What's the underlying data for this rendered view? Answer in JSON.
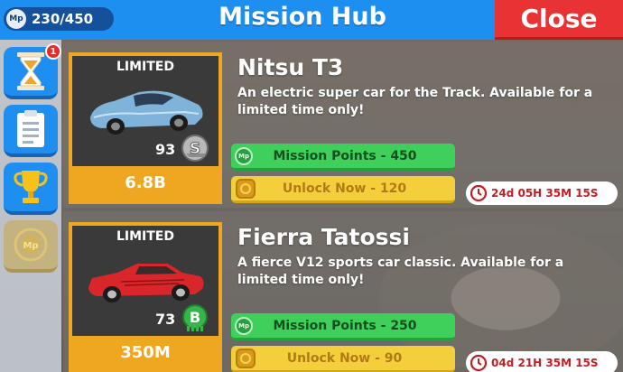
{
  "header": {
    "mission_points": "230/450",
    "mp_badge": "Mp",
    "title": "Mission Hub",
    "close_label": "Close"
  },
  "sidebar": {
    "notification_count": "1",
    "items": [
      {
        "name": "hourglass",
        "icon": "hourglass-icon"
      },
      {
        "name": "clipboard",
        "icon": "clipboard-icon"
      },
      {
        "name": "trophy",
        "icon": "trophy-icon"
      },
      {
        "name": "mission-points",
        "icon": "mp-icon",
        "label": "Mp",
        "disabled": true
      }
    ]
  },
  "colors": {
    "header_blue": "#1c8ff0",
    "close_red": "#e83234",
    "mission_green": "#3fd05c",
    "unlock_yellow": "#f4cf3c",
    "card_frame_gold": "#efa621",
    "timer_red": "#c51d23"
  },
  "missions": [
    {
      "badge": "LIMITED",
      "name": "Nitsu T3",
      "description": "An electric super car for the Track. Available for a limited time only!",
      "level": "93",
      "class_letter": "S",
      "price": "6.8B",
      "mp_icon_label": "Mp",
      "mission_points_label": "Mission Points - 450",
      "unlock_label": "Unlock Now - 120",
      "timer": "24d 05H 35M 15S",
      "car_color": "#7fb3d9"
    },
    {
      "badge": "LIMITED",
      "name": "Fierra Tatossi",
      "description": "A fierce V12 sports car classic. Available for a limited time only!",
      "level": "73",
      "class_letter": "B",
      "price": "350M",
      "mp_icon_label": "Mp",
      "mission_points_label": "Mission Points - 250",
      "unlock_label": "Unlock Now - 90",
      "timer": "04d 21H 35M 15S",
      "car_color": "#d9262a"
    }
  ]
}
